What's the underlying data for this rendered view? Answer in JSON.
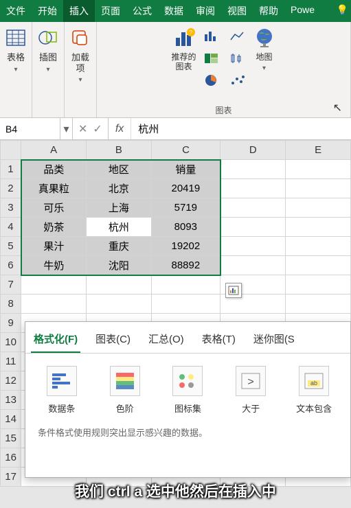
{
  "tabs": {
    "file": "文件",
    "home": "开始",
    "insert": "插入",
    "layout": "页面",
    "formula": "公式",
    "data": "数据",
    "review": "审阅",
    "view": "视图",
    "help": "帮助",
    "power": "Powe"
  },
  "ribbon": {
    "table": "表格",
    "illustration": "插图",
    "addins": "加载\n项",
    "recommended": "推荐的\n图表",
    "maps": "地图",
    "charts_group": "图表"
  },
  "formula_bar": {
    "name_box": "B4",
    "fx": "fx",
    "value": "杭州"
  },
  "columns": [
    "A",
    "B",
    "C",
    "D",
    "E"
  ],
  "rows": [
    {
      "n": "1",
      "a": "品类",
      "b": "地区",
      "c": "销量"
    },
    {
      "n": "2",
      "a": "真果粒",
      "b": "北京",
      "c": "20419"
    },
    {
      "n": "3",
      "a": "可乐",
      "b": "上海",
      "c": "5719"
    },
    {
      "n": "4",
      "a": "奶茶",
      "b": "杭州",
      "c": "8093"
    },
    {
      "n": "5",
      "a": "果汁",
      "b": "重庆",
      "c": "19202"
    },
    {
      "n": "6",
      "a": "牛奶",
      "b": "沈阳",
      "c": "88892"
    }
  ],
  "empty_rows": [
    "7",
    "8",
    "9",
    "10",
    "11",
    "12",
    "13",
    "14",
    "15",
    "16",
    "17"
  ],
  "panel": {
    "tabs": {
      "format": "格式化(F)",
      "charts": "图表(C)",
      "totals": "汇总(O)",
      "tables": "表格(T)",
      "sparklines": "迷你图(S"
    },
    "items": {
      "databars": "数据条",
      "colorscale": "色阶",
      "iconset": "图标集",
      "greater": "大于",
      "textcontains": "文本包含"
    },
    "desc": "条件格式使用规则突出显示感兴趣的数据。"
  },
  "subtitle": "我们 ctrl a 选中他然后在插入中"
}
